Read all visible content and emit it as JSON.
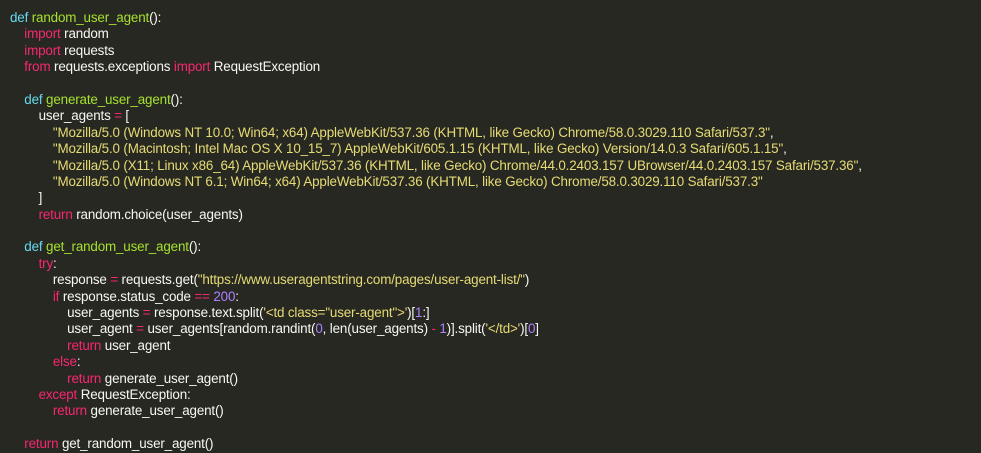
{
  "editor": {
    "lines": [
      [
        {
          "c": "kw",
          "t": "def "
        },
        {
          "c": "fn",
          "t": "random_user_agent"
        },
        {
          "c": "pl",
          "t": "():"
        }
      ],
      [
        {
          "c": "pl",
          "t": "    "
        },
        {
          "c": "kw2",
          "t": "import"
        },
        {
          "c": "pl",
          "t": " random"
        }
      ],
      [
        {
          "c": "pl",
          "t": "    "
        },
        {
          "c": "kw2",
          "t": "import"
        },
        {
          "c": "pl",
          "t": " requests"
        }
      ],
      [
        {
          "c": "pl",
          "t": "    "
        },
        {
          "c": "kw2",
          "t": "from"
        },
        {
          "c": "pl",
          "t": " requests.exceptions "
        },
        {
          "c": "kw2",
          "t": "import"
        },
        {
          "c": "pl",
          "t": " RequestException"
        }
      ],
      [],
      [
        {
          "c": "pl",
          "t": "    "
        },
        {
          "c": "kw",
          "t": "def "
        },
        {
          "c": "fn",
          "t": "generate_user_agent"
        },
        {
          "c": "pl",
          "t": "():"
        }
      ],
      [
        {
          "c": "pl",
          "t": "        user_agents "
        },
        {
          "c": "op",
          "t": "="
        },
        {
          "c": "pl",
          "t": " ["
        }
      ],
      [
        {
          "c": "pl",
          "t": "            "
        },
        {
          "c": "str",
          "t": "\"Mozilla/5.0 (Windows NT 10.0; Win64; x64) AppleWebKit/537.36 (KHTML, like Gecko) Chrome/58.0.3029.110 Safari/537.3\""
        },
        {
          "c": "pl",
          "t": ","
        }
      ],
      [
        {
          "c": "pl",
          "t": "            "
        },
        {
          "c": "str",
          "t": "\"Mozilla/5.0 (Macintosh; Intel Mac OS X 10_15_7) AppleWebKit/605.1.15 (KHTML, like Gecko) Version/14.0.3 Safari/605.1.15\""
        },
        {
          "c": "pl",
          "t": ","
        }
      ],
      [
        {
          "c": "pl",
          "t": "            "
        },
        {
          "c": "str",
          "t": "\"Mozilla/5.0 (X11; Linux x86_64) AppleWebKit/537.36 (KHTML, like Gecko) Chrome/44.0.2403.157 UBrowser/44.0.2403.157 Safari/537.36\""
        },
        {
          "c": "pl",
          "t": ","
        }
      ],
      [
        {
          "c": "pl",
          "t": "            "
        },
        {
          "c": "str",
          "t": "\"Mozilla/5.0 (Windows NT 6.1; Win64; x64) AppleWebKit/537.36 (KHTML, like Gecko) Chrome/58.0.3029.110 Safari/537.3\""
        }
      ],
      [
        {
          "c": "pl",
          "t": "        ]"
        }
      ],
      [
        {
          "c": "pl",
          "t": "        "
        },
        {
          "c": "kw2",
          "t": "return"
        },
        {
          "c": "pl",
          "t": " random.choice(user_agents)"
        }
      ],
      [],
      [
        {
          "c": "pl",
          "t": "    "
        },
        {
          "c": "kw",
          "t": "def "
        },
        {
          "c": "fn",
          "t": "get_random_user_agent"
        },
        {
          "c": "pl",
          "t": "():"
        }
      ],
      [
        {
          "c": "pl",
          "t": "        "
        },
        {
          "c": "kw2",
          "t": "try"
        },
        {
          "c": "pl",
          "t": ":"
        }
      ],
      [
        {
          "c": "pl",
          "t": "            response "
        },
        {
          "c": "op",
          "t": "="
        },
        {
          "c": "pl",
          "t": " requests.get("
        },
        {
          "c": "str",
          "t": "\"https://www.useragentstring.com/pages/user-agent-list/\""
        },
        {
          "c": "pl",
          "t": ")"
        }
      ],
      [
        {
          "c": "pl",
          "t": "            "
        },
        {
          "c": "kw2",
          "t": "if"
        },
        {
          "c": "pl",
          "t": " response.status_code "
        },
        {
          "c": "op",
          "t": "=="
        },
        {
          "c": "pl",
          "t": " "
        },
        {
          "c": "num",
          "t": "200"
        },
        {
          "c": "pl",
          "t": ":"
        }
      ],
      [
        {
          "c": "pl",
          "t": "                user_agents "
        },
        {
          "c": "op",
          "t": "="
        },
        {
          "c": "pl",
          "t": " response.text.split("
        },
        {
          "c": "str",
          "t": "'<td class=\"user-agent\">'"
        },
        {
          "c": "pl",
          "t": ")["
        },
        {
          "c": "num",
          "t": "1"
        },
        {
          "c": "pl",
          "t": ":]"
        }
      ],
      [
        {
          "c": "pl",
          "t": "                user_agent "
        },
        {
          "c": "op",
          "t": "="
        },
        {
          "c": "pl",
          "t": " user_agents[random.randint("
        },
        {
          "c": "num",
          "t": "0"
        },
        {
          "c": "pl",
          "t": ", len(user_agents) "
        },
        {
          "c": "op",
          "t": "-"
        },
        {
          "c": "pl",
          "t": " "
        },
        {
          "c": "num",
          "t": "1"
        },
        {
          "c": "pl",
          "t": ")].split("
        },
        {
          "c": "str",
          "t": "'</td>'"
        },
        {
          "c": "pl",
          "t": ")["
        },
        {
          "c": "num",
          "t": "0"
        },
        {
          "c": "pl",
          "t": "]"
        }
      ],
      [
        {
          "c": "pl",
          "t": "                "
        },
        {
          "c": "kw2",
          "t": "return"
        },
        {
          "c": "pl",
          "t": " user_agent"
        }
      ],
      [
        {
          "c": "pl",
          "t": "            "
        },
        {
          "c": "kw2",
          "t": "else"
        },
        {
          "c": "pl",
          "t": ":"
        }
      ],
      [
        {
          "c": "pl",
          "t": "                "
        },
        {
          "c": "kw2",
          "t": "return"
        },
        {
          "c": "pl",
          "t": " generate_user_agent()"
        }
      ],
      [
        {
          "c": "pl",
          "t": "        "
        },
        {
          "c": "kw2",
          "t": "except"
        },
        {
          "c": "pl",
          "t": " RequestException:"
        }
      ],
      [
        {
          "c": "pl",
          "t": "            "
        },
        {
          "c": "kw2",
          "t": "return"
        },
        {
          "c": "pl",
          "t": " generate_user_agent()"
        }
      ],
      [],
      [
        {
          "c": "pl",
          "t": "    "
        },
        {
          "c": "kw2",
          "t": "return"
        },
        {
          "c": "pl",
          "t": " get_random_user_agent()"
        }
      ]
    ]
  }
}
